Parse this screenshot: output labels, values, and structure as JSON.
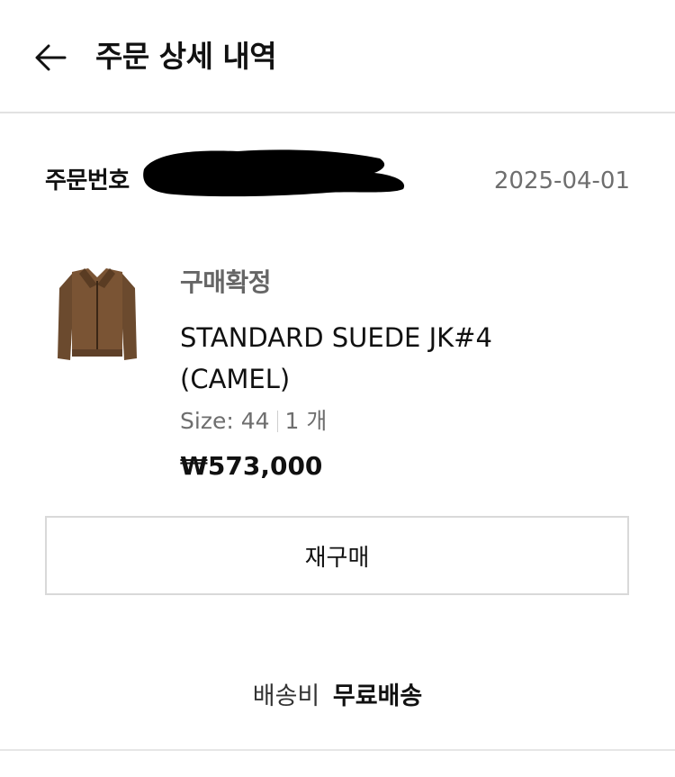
{
  "header": {
    "title": "주문 상세 내역",
    "back_icon": "arrow-left-icon"
  },
  "order": {
    "number_label": "주문번호",
    "date": "2025-04-01"
  },
  "product": {
    "status": "구매확정",
    "name": "STANDARD SUEDE JK#4 (CAMEL)",
    "size": "Size: 44",
    "quantity": "1 개",
    "price": "₩573,000",
    "thumbnail_color": "#6b4a2e"
  },
  "actions": {
    "rebuy_label": "재구매"
  },
  "shipping": {
    "label": "배송비",
    "value": "무료배송"
  },
  "colors": {
    "text": "#111111",
    "muted": "#6e6e6e",
    "border": "#d9d9d9"
  }
}
